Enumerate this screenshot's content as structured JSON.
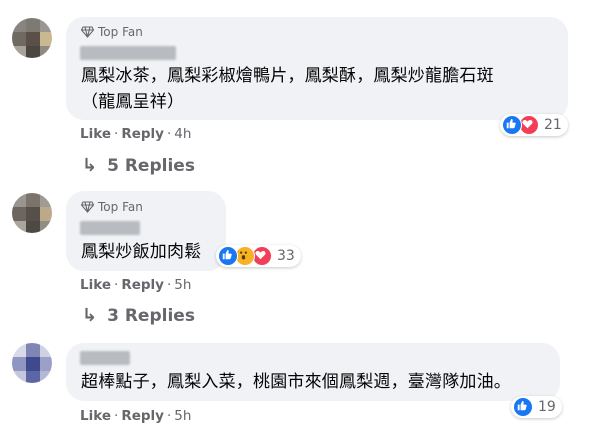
{
  "comments": [
    {
      "badge": "Top Fan",
      "text_line1": "鳳梨冰茶，鳳梨彩椒燴鴨片，鳳梨酥，鳳梨炒龍膽石斑",
      "text_line2": "（龍鳳呈祥）",
      "like": "Like",
      "reply": "Reply",
      "time": "4h",
      "reaction_count": "21",
      "replies_label": "5 Replies"
    },
    {
      "badge": "Top Fan",
      "text_line1": "鳳梨炒飯加肉鬆",
      "like": "Like",
      "reply": "Reply",
      "time": "5h",
      "reaction_count": "33",
      "replies_label": "3 Replies"
    },
    {
      "text_line1": "超棒點子，鳳梨入菜，桃園市來個鳳梨週，臺灣隊加油。",
      "like": "Like",
      "reply": "Reply",
      "time": "5h",
      "reaction_count": "19"
    }
  ],
  "colors": {
    "like_blue": "#1877f2",
    "love_red": "#f33e58",
    "wow_yellow": "#f7b125",
    "bubble_bg": "#f0f2f5",
    "meta_gray": "#65676b"
  },
  "icons": [
    "diamond-icon",
    "like-reaction-icon",
    "love-reaction-icon",
    "wow-reaction-icon",
    "reply-arrow-icon"
  ]
}
